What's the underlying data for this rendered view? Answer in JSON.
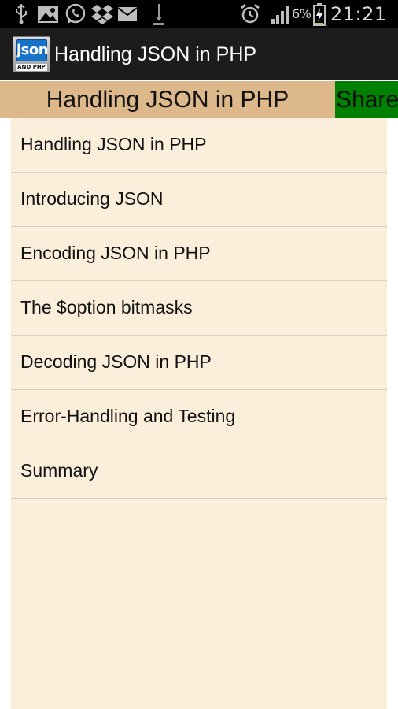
{
  "status_bar": {
    "icons_left": [
      "usb-icon",
      "gallery-icon",
      "whatsapp-icon",
      "dropbox-icon",
      "mail-icon",
      "download-icon"
    ],
    "icons_right": [
      "alarm-icon",
      "signal-icon",
      "battery-charging-icon"
    ],
    "battery_percent": "6%",
    "time": "21:21"
  },
  "app_bar": {
    "logo_text_top": "json",
    "logo_text_bottom": "AND PHP",
    "title": "Handling JSON in PHP"
  },
  "header": {
    "title": "Handling JSON in PHP",
    "share_label": "Share"
  },
  "chapters": [
    {
      "label": "Handling JSON in PHP"
    },
    {
      "label": "Introducing JSON"
    },
    {
      "label": "Encoding JSON in PHP"
    },
    {
      "label": "The $option bitmasks"
    },
    {
      "label": "Decoding JSON in PHP"
    },
    {
      "label": "Error-Handling and Testing"
    },
    {
      "label": "Summary"
    }
  ],
  "colors": {
    "status_bar_bg": "#000000",
    "app_bar_bg": "#1c1c1c",
    "header_bg": "#ddb88a",
    "share_bg": "#008000",
    "list_bg": "#fbeedb",
    "divider": "#d8d0c4",
    "charging_accent": "#9fd82c"
  }
}
